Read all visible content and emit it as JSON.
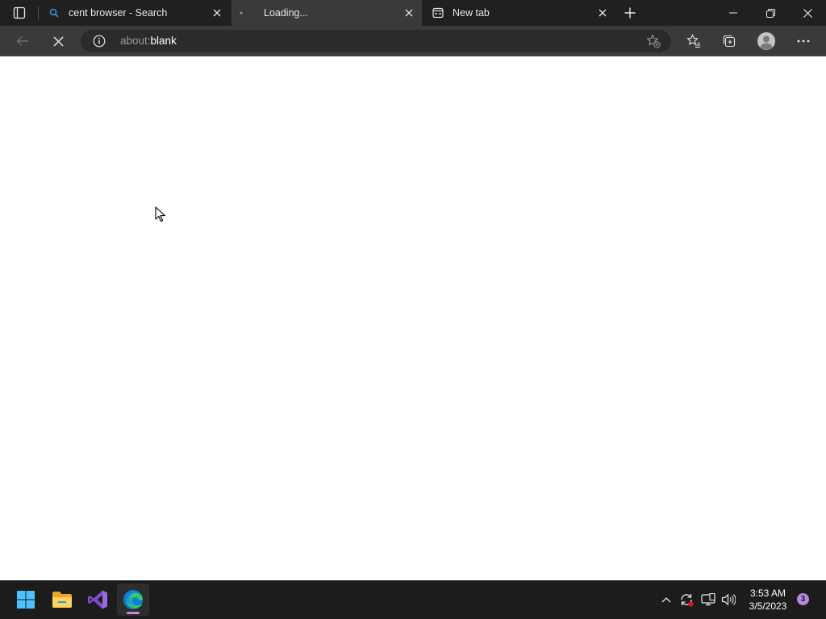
{
  "browser": {
    "tabs": [
      {
        "title": "cent browser - Search",
        "favicon": "search-icon",
        "active": false
      },
      {
        "title": "Loading...",
        "favicon": "loading-dot-icon",
        "active": true
      },
      {
        "title": "New tab",
        "favicon": "newtab-page-icon",
        "active": false
      }
    ],
    "address": {
      "scheme": "about:",
      "host": "blank"
    },
    "window_controls": [
      "minimize-icon",
      "restore-icon",
      "close-icon"
    ],
    "toolbar_icons": [
      "back-arrow-icon",
      "stop-loading-icon",
      "info-icon",
      "add-favorite-icon",
      "favorites-icon",
      "collections-icon",
      "profile-icon",
      "more-icon"
    ]
  },
  "taskbar": {
    "apps": [
      "windows-start-icon",
      "file-explorer-icon",
      "visual-studio-icon",
      "edge-icon"
    ],
    "tray": [
      "chevron-up-icon",
      "sync-icon",
      "network-icon",
      "volume-icon"
    ],
    "time": "3:53 AM",
    "date": "3/5/2023",
    "notification_count": "3"
  },
  "colors": {
    "titlebar": "#202020",
    "toolbar": "#3a3a3a",
    "taskbar": "#1c1c1c",
    "accent": "#0078d4"
  }
}
